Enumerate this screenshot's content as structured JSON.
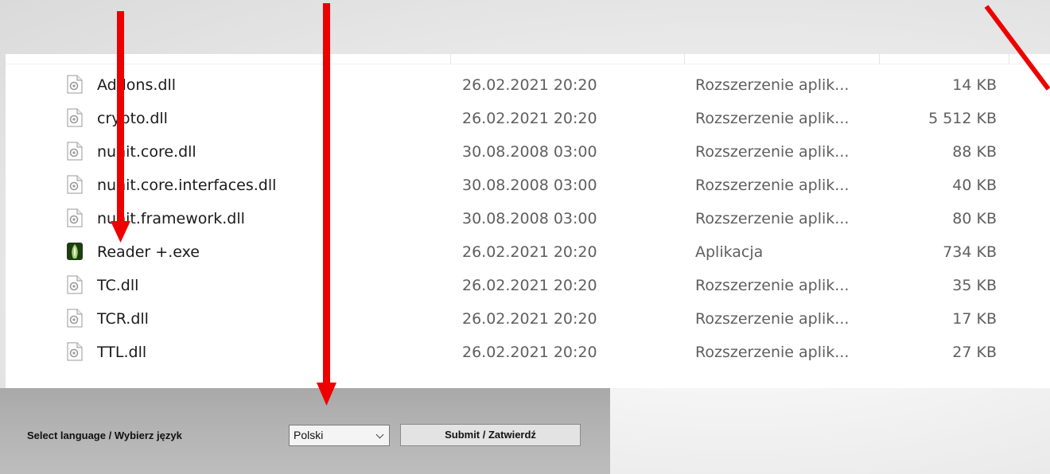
{
  "files": [
    {
      "name": "Addons.dll",
      "date": "26.02.2021 20:20",
      "type": "Rozszerzenie aplik...",
      "size": "14 KB",
      "icon": "dll-file-icon"
    },
    {
      "name": "crypto.dll",
      "date": "26.02.2021 20:20",
      "type": "Rozszerzenie aplik...",
      "size": "5 512 KB",
      "icon": "dll-file-icon"
    },
    {
      "name": "nunit.core.dll",
      "date": "30.08.2008 03:00",
      "type": "Rozszerzenie aplik...",
      "size": "88 KB",
      "icon": "dll-file-icon"
    },
    {
      "name": "nunit.core.interfaces.dll",
      "date": "30.08.2008 03:00",
      "type": "Rozszerzenie aplik...",
      "size": "40 KB",
      "icon": "dll-file-icon"
    },
    {
      "name": "nunit.framework.dll",
      "date": "30.08.2008 03:00",
      "type": "Rozszerzenie aplik...",
      "size": "80 KB",
      "icon": "dll-file-icon"
    },
    {
      "name": "Reader +.exe",
      "date": "26.02.2021 20:20",
      "type": "Aplikacja",
      "size": "734 KB",
      "icon": "exe-app-icon"
    },
    {
      "name": "TC.dll",
      "date": "26.02.2021 20:20",
      "type": "Rozszerzenie aplik...",
      "size": "35 KB",
      "icon": "dll-file-icon"
    },
    {
      "name": "TCR.dll",
      "date": "26.02.2021 20:20",
      "type": "Rozszerzenie aplik...",
      "size": "17 KB",
      "icon": "dll-file-icon"
    },
    {
      "name": "TTL.dll",
      "date": "26.02.2021 20:20",
      "type": "Rozszerzenie aplik...",
      "size": "27 KB",
      "icon": "dll-file-icon"
    }
  ],
  "language_dialog": {
    "label": "Select language / Wybierz język",
    "selected_language": "Polski",
    "submit_label": "Submit / Zatwierdź"
  },
  "annotation_color": "#ee0000"
}
